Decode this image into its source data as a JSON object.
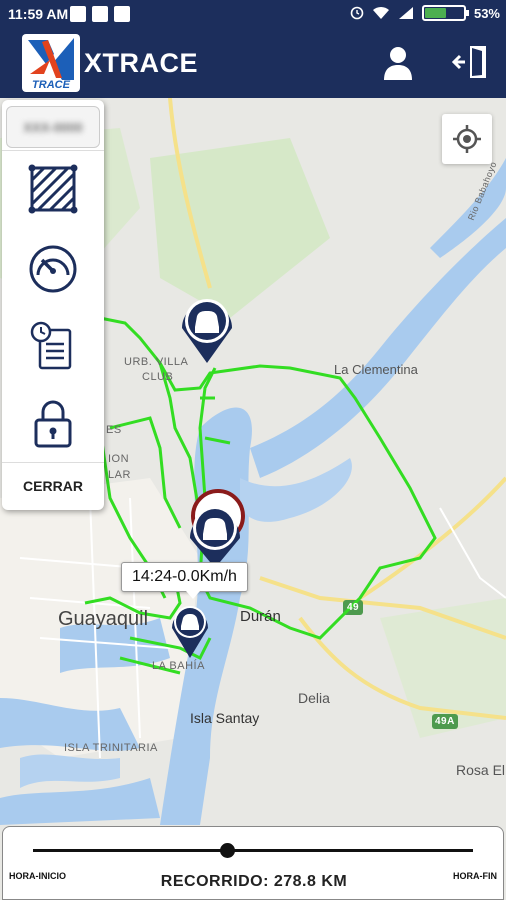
{
  "status_bar": {
    "time": "11:59 AM",
    "battery": "53%",
    "battery_level": 0.53
  },
  "app_bar": {
    "title": "XTRACE",
    "logo_text": "TRACE",
    "user_icon": "user-icon",
    "logout_icon": "logout-door-icon"
  },
  "map": {
    "labels": {
      "la_clementina": "La Clementina",
      "urb_villa": "URB. VILLA",
      "club": "CLUB",
      "guayaquil": "Guayaquil",
      "duran": "Durán",
      "delia": "Delia",
      "isla_santay": "Isla Santay",
      "isla_trinitaria": "ISLA TRINITARIA",
      "la_bahia": "LA BAHÍA",
      "rosa_el": "Rosa El",
      "road_49": "49",
      "road_49a": "49A",
      "rio_babahoyo": "Rio Babahoyo",
      "es": "ES",
      "ion": "ION",
      "lar": "LAR"
    },
    "locate_icon": "locate-crosshair-icon",
    "route_color": "#33dd22"
  },
  "side_menu": {
    "plate": "XXX-0000",
    "items": [
      {
        "name": "geofence-icon"
      },
      {
        "name": "speedometer-icon"
      },
      {
        "name": "history-report-icon"
      },
      {
        "name": "lock-icon"
      }
    ],
    "close_label": "CERRAR"
  },
  "tooltip": {
    "text": "14:24-0.0Km/h"
  },
  "bottom_panel": {
    "start_label": "HORA-INICIO",
    "end_label": "HORA-FIN",
    "distance": "RECORRIDO: 278.8 KM",
    "slider_position": 0.44
  }
}
